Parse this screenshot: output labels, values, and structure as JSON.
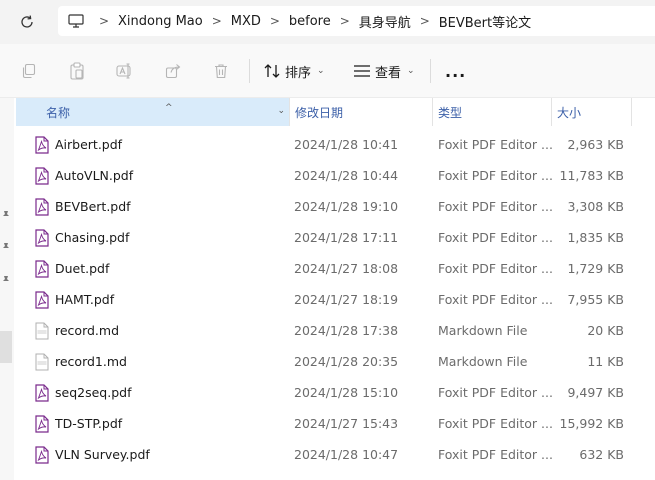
{
  "address_bar": {
    "breadcrumbs": [
      "Xindong Mao",
      "MXD",
      "before",
      "具身导航",
      "BEVBert等论文"
    ],
    "separator": ">"
  },
  "command_bar": {
    "sort_label": "排序",
    "view_label": "查看",
    "more_label": "..."
  },
  "columns": {
    "name": "名称",
    "date": "修改日期",
    "type": "类型",
    "size": "大小"
  },
  "files": [
    {
      "name": "Airbert.pdf",
      "date": "2024/1/28 10:41",
      "type": "Foxit PDF Editor ...",
      "size": "2,963 KB",
      "icon": "pdf-icon"
    },
    {
      "name": "AutoVLN.pdf",
      "date": "2024/1/28 10:44",
      "type": "Foxit PDF Editor ...",
      "size": "11,783 KB",
      "icon": "pdf-icon"
    },
    {
      "name": "BEVBert.pdf",
      "date": "2024/1/28 19:10",
      "type": "Foxit PDF Editor ...",
      "size": "3,308 KB",
      "icon": "pdf-icon"
    },
    {
      "name": "Chasing.pdf",
      "date": "2024/1/28 17:11",
      "type": "Foxit PDF Editor ...",
      "size": "1,835 KB",
      "icon": "pdf-icon"
    },
    {
      "name": "Duet.pdf",
      "date": "2024/1/27 18:08",
      "type": "Foxit PDF Editor ...",
      "size": "1,729 KB",
      "icon": "pdf-icon"
    },
    {
      "name": "HAMT.pdf",
      "date": "2024/1/27 18:19",
      "type": "Foxit PDF Editor ...",
      "size": "7,955 KB",
      "icon": "pdf-icon"
    },
    {
      "name": "record.md",
      "date": "2024/1/28 17:38",
      "type": "Markdown File",
      "size": "20 KB",
      "icon": "md-file-icon"
    },
    {
      "name": "record1.md",
      "date": "2024/1/28 20:35",
      "type": "Markdown File",
      "size": "11 KB",
      "icon": "md-file-icon"
    },
    {
      "name": "seq2seq.pdf",
      "date": "2024/1/28 15:10",
      "type": "Foxit PDF Editor ...",
      "size": "9,497 KB",
      "icon": "pdf-icon"
    },
    {
      "name": "TD-STP.pdf",
      "date": "2024/1/27 15:43",
      "type": "Foxit PDF Editor ...",
      "size": "15,992 KB",
      "icon": "pdf-icon"
    },
    {
      "name": "VLN Survey.pdf",
      "date": "2024/1/28 10:47",
      "type": "Foxit PDF Editor ...",
      "size": "632 KB",
      "icon": "pdf-icon"
    }
  ],
  "colors": {
    "header_selected_bg": "#d9ebfa",
    "header_text": "#3b5fa8",
    "pdf_icon": "#7a2a8c",
    "secondary_text": "#6b6b6b"
  }
}
